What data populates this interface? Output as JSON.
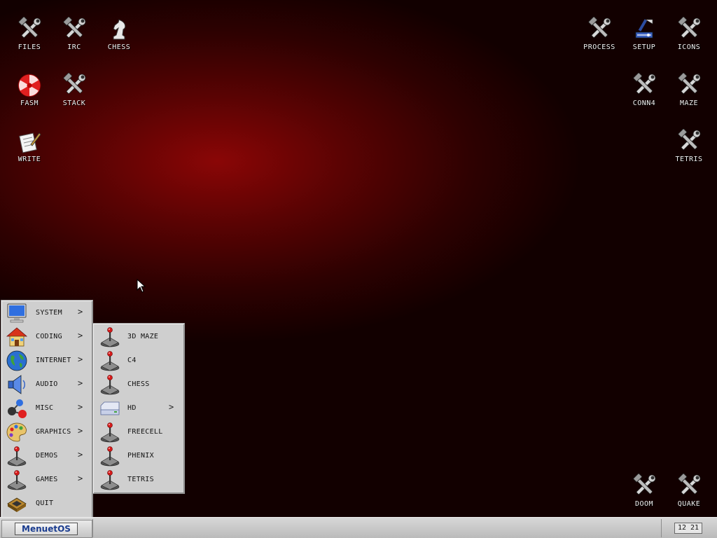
{
  "desktop": {
    "icons_left": [
      {
        "label": "FILES",
        "icon": "tools-icon"
      },
      {
        "label": "IRC",
        "icon": "tools-icon"
      },
      {
        "label": "CHESS",
        "icon": "chess-knight-icon"
      },
      {
        "label": "FASM",
        "icon": "radiation-icon"
      },
      {
        "label": "STACK",
        "icon": "tools-icon"
      },
      {
        "label": "WRITE",
        "icon": "writing-icon"
      }
    ],
    "icons_right": [
      {
        "label": "PROCESS",
        "icon": "tools-icon"
      },
      {
        "label": "SETUP",
        "icon": "setup-icon"
      },
      {
        "label": "ICONS",
        "icon": "tools-icon"
      },
      {
        "label": "CONN4",
        "icon": "tools-icon"
      },
      {
        "label": "MAZE",
        "icon": "tools-icon"
      },
      {
        "label": "TETRIS",
        "icon": "tools-icon"
      },
      {
        "label": "DOOM",
        "icon": "tools-icon"
      },
      {
        "label": "QUAKE",
        "icon": "tools-icon"
      }
    ]
  },
  "main_menu": {
    "items": [
      {
        "label": "SYSTEM",
        "icon": "monitor-icon",
        "submenu": true
      },
      {
        "label": "CODING",
        "icon": "house-icon",
        "submenu": true
      },
      {
        "label": "INTERNET",
        "icon": "globe-icon",
        "submenu": true
      },
      {
        "label": "AUDIO",
        "icon": "speaker-icon",
        "submenu": true
      },
      {
        "label": "MISC",
        "icon": "molecule-icon",
        "submenu": true
      },
      {
        "label": "GRAPHICS",
        "icon": "palette-icon",
        "submenu": true
      },
      {
        "label": "DEMOS",
        "icon": "joystick-icon",
        "submenu": true
      },
      {
        "label": "GAMES",
        "icon": "joystick-icon",
        "submenu": true
      },
      {
        "label": "QUIT",
        "icon": "chip-icon",
        "submenu": false
      }
    ],
    "arrow": ">"
  },
  "games_submenu": {
    "items": [
      {
        "label": "3D MAZE",
        "icon": "joystick-icon",
        "submenu": false
      },
      {
        "label": "C4",
        "icon": "joystick-icon",
        "submenu": false
      },
      {
        "label": "CHESS",
        "icon": "joystick-icon",
        "submenu": false
      },
      {
        "label": "HD",
        "icon": "drive-icon",
        "submenu": true
      },
      {
        "label": "FREECELL",
        "icon": "joystick-icon",
        "submenu": false
      },
      {
        "label": "PHENIX",
        "icon": "joystick-icon",
        "submenu": false
      },
      {
        "label": "TETRIS",
        "icon": "joystick-icon",
        "submenu": false
      }
    ]
  },
  "taskbar": {
    "start_label": "MenuetOS",
    "clock": "12 21"
  },
  "colors": {
    "desktop_center": "#8a0606",
    "desktop_edge": "#0c0000",
    "menu_bg": "#cfcfcf",
    "brand_text": "#1a3c8f"
  }
}
